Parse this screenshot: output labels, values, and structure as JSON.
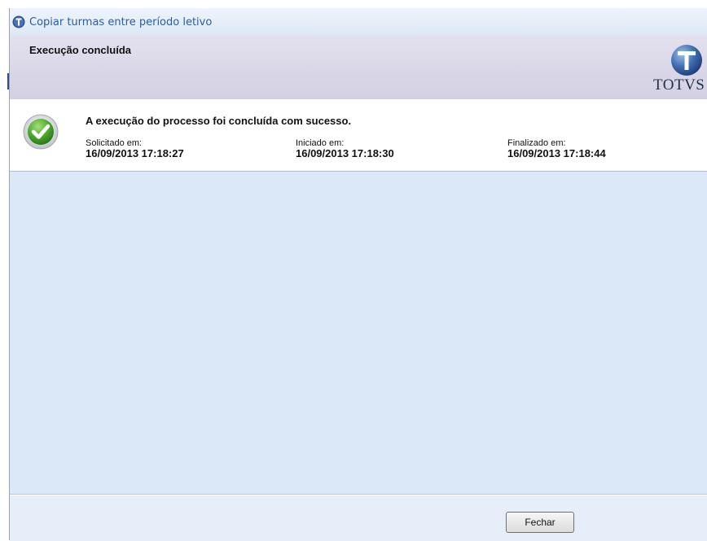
{
  "window": {
    "title": "Copiar turmas entre período letivo"
  },
  "header": {
    "title": "Execução concluída",
    "logo_text": "TOTVS"
  },
  "status": {
    "message": "A execução do processo foi concluída com sucesso.",
    "requested": {
      "label": "Solicitado em:",
      "value": "16/09/2013 17:18:27"
    },
    "started": {
      "label": "Iniciado em:",
      "value": "16/09/2013 17:18:30"
    },
    "finished": {
      "label": "Finalizado em:",
      "value": "16/09/2013 17:18:44"
    }
  },
  "footer": {
    "close_label": "Fechar"
  },
  "colors": {
    "accent": "#2b5d9e",
    "success": "#4aa82c",
    "panel_background": "#dbe8f7",
    "header_background": "#d8d6e6"
  },
  "icons": {
    "title": "totvs-logo-icon",
    "status": "success-check-icon"
  }
}
